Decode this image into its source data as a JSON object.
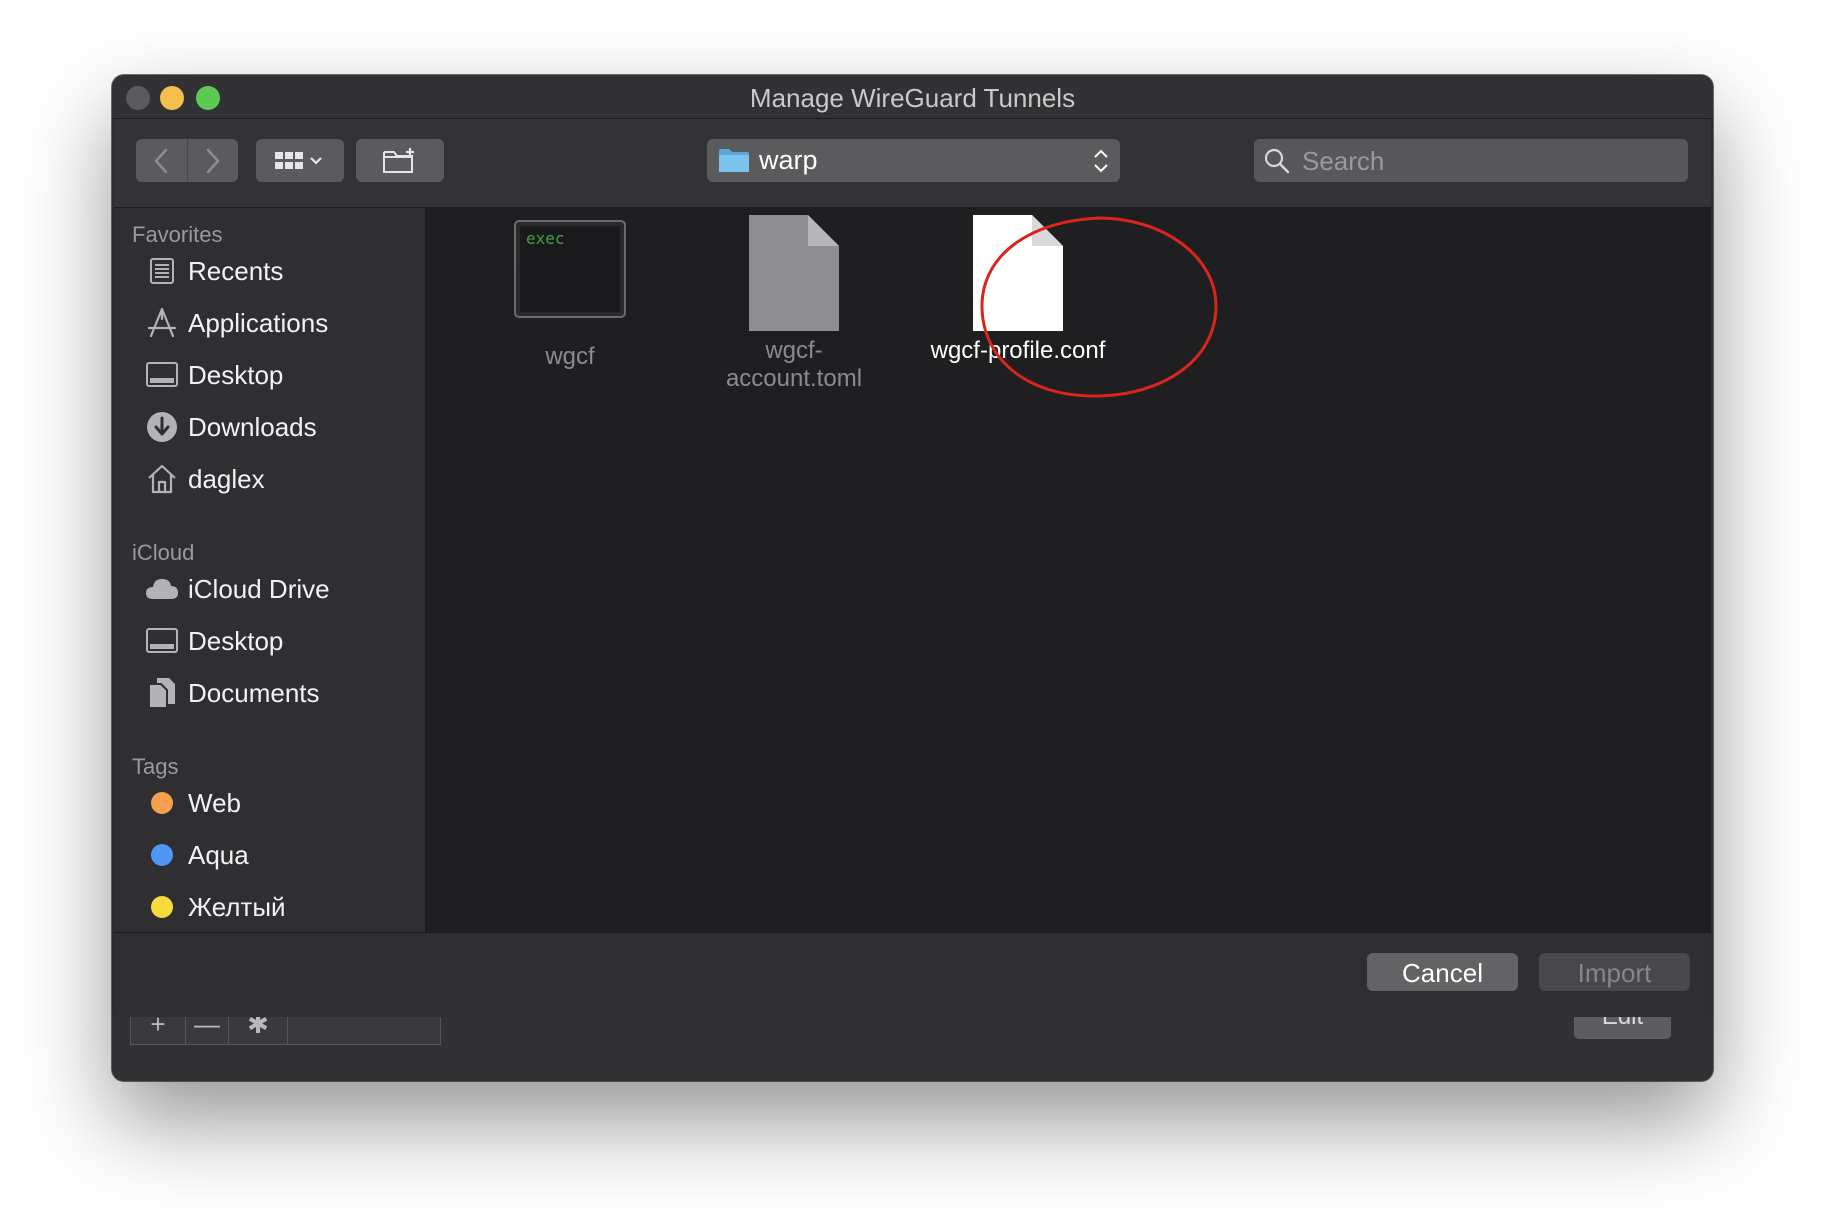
{
  "window": {
    "title": "Manage WireGuard Tunnels"
  },
  "toolbar": {
    "back_icon": "chevron-left-icon",
    "forward_icon": "chevron-right-icon",
    "view_icon": "icon-grid-view-icon",
    "new_folder_icon": "new-folder-icon",
    "location": "warp",
    "search_placeholder": "Search"
  },
  "sidebar": {
    "favorites_header": "Favorites",
    "favorites": [
      {
        "label": "Recents",
        "icon": "recents-icon"
      },
      {
        "label": "Applications",
        "icon": "applications-icon"
      },
      {
        "label": "Desktop",
        "icon": "desktop-icon"
      },
      {
        "label": "Downloads",
        "icon": "downloads-icon"
      },
      {
        "label": "daglex",
        "icon": "home-icon"
      }
    ],
    "icloud_header": "iCloud",
    "icloud": [
      {
        "label": "iCloud Drive",
        "icon": "cloud-icon"
      },
      {
        "label": "Desktop",
        "icon": "desktop-icon"
      },
      {
        "label": "Documents",
        "icon": "documents-icon"
      }
    ],
    "tags_header": "Tags",
    "tags": [
      {
        "label": "Web",
        "color": "#f5a04f"
      },
      {
        "label": "Aqua",
        "color": "#4f97f5"
      },
      {
        "label": "Желтый",
        "color": "#f5dc3c"
      }
    ]
  },
  "files": [
    {
      "name": "wgcf",
      "kind": "executable",
      "badge": "exec",
      "selected": false
    },
    {
      "name": "wgcf-account.toml",
      "name_line1": "wgcf-",
      "name_line2": "account.toml",
      "kind": "document",
      "selected": false
    },
    {
      "name": "wgcf-profile.conf",
      "kind": "document",
      "selected": true,
      "annotation": "red-circle"
    }
  ],
  "footer": {
    "cancel_label": "Cancel",
    "import_label": "Import"
  },
  "background_window": {
    "add_label": "+",
    "remove_label": "—",
    "edit_label": "Edit"
  }
}
